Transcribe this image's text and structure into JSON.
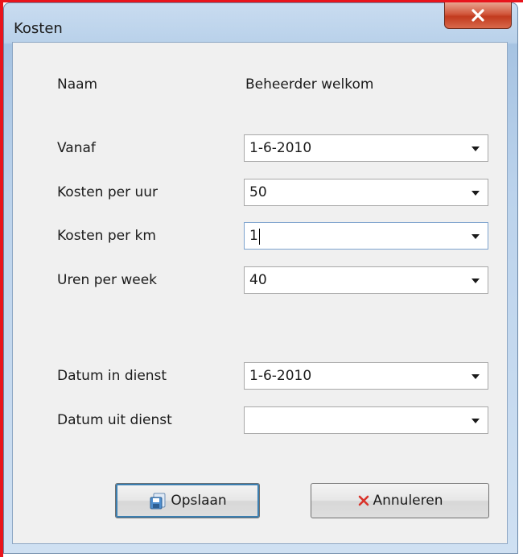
{
  "window": {
    "title": "Kosten"
  },
  "close_button": {
    "label": "X"
  },
  "form": {
    "naam_label": "Naam",
    "naam_value": "Beheerder welkom",
    "fields": [
      {
        "label": "Vanaf",
        "value": "1-6-2010"
      },
      {
        "label": "Kosten per uur",
        "value": "50"
      },
      {
        "label": "Kosten per km",
        "value": "1"
      },
      {
        "label": "Uren per week",
        "value": "40"
      },
      {
        "label": "Datum in dienst",
        "value": "1-6-2010"
      },
      {
        "label": "Datum uit dienst",
        "value": ""
      }
    ]
  },
  "buttons": {
    "save_label": "Opslaan",
    "save_icon": "save-disk-icon",
    "cancel_label": "Annuleren",
    "cancel_icon": "red-x-icon"
  },
  "colors": {
    "frame_accent": "#e8141c",
    "close_button": "#c23a1e",
    "cancel_icon": "#d9332a",
    "focus_border": "#7da2ce"
  }
}
